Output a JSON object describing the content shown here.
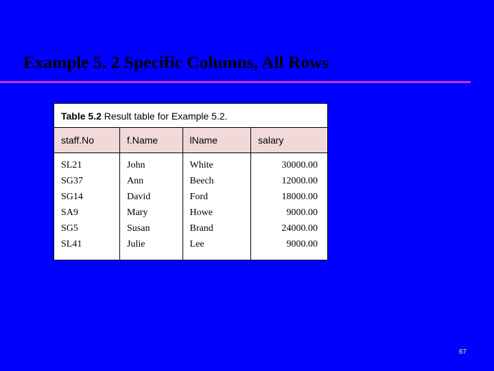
{
  "slide": {
    "title": "Example 5. 2  Specific Columns, All Rows",
    "page_number": "67"
  },
  "table": {
    "caption_bold": "Table 5.2",
    "caption_rest": "   Result table for Example 5.2.",
    "headers": [
      "staff.No",
      "f.Name",
      "lName",
      "salary"
    ],
    "rows": [
      {
        "c0": "SL21",
        "c1": "John",
        "c2": "White",
        "c3": "30000.00"
      },
      {
        "c0": "SG37",
        "c1": "Ann",
        "c2": "Beech",
        "c3": "12000.00"
      },
      {
        "c0": "SG14",
        "c1": "David",
        "c2": "Ford",
        "c3": "18000.00"
      },
      {
        "c0": "SA9",
        "c1": "Mary",
        "c2": "Howe",
        "c3": "9000.00"
      },
      {
        "c0": "SG5",
        "c1": "Susan",
        "c2": "Brand",
        "c3": "24000.00"
      },
      {
        "c0": "SL41",
        "c1": "Julie",
        "c2": "Lee",
        "c3": "9000.00"
      }
    ]
  }
}
